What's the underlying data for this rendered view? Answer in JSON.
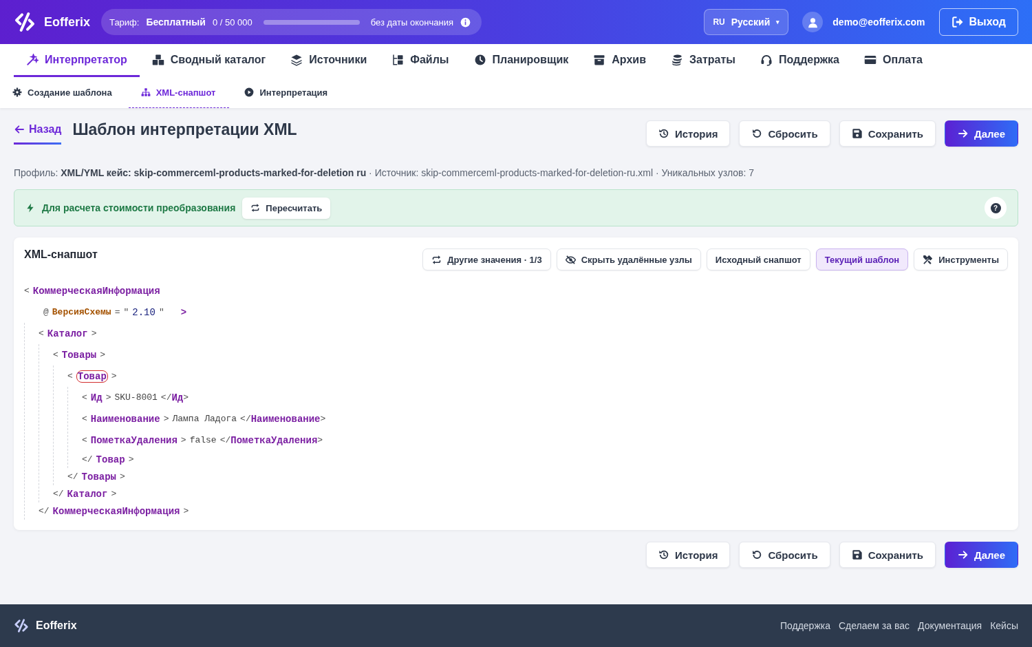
{
  "header": {
    "brand": "Eofferix",
    "plan": {
      "label": "Тариф:",
      "name": "Бесплатный",
      "usage": "0 / 50 000",
      "level": 0,
      "expiry": "без даты окончания"
    },
    "language": {
      "code": "RU",
      "name": "Русский",
      "caret": "▾"
    },
    "user": "demo@eofferix.com",
    "logout": "Выход"
  },
  "nav": [
    {
      "label": "Интерпретатор",
      "selected": true
    },
    {
      "label": "Сводный каталог",
      "selected": false
    },
    {
      "label": "Источники",
      "selected": false
    },
    {
      "label": "Файлы",
      "selected": false
    },
    {
      "label": "Планировщик",
      "selected": false
    },
    {
      "label": "Архив",
      "selected": false
    },
    {
      "label": "Затраты",
      "selected": false
    },
    {
      "label": "Поддержка",
      "selected": false
    },
    {
      "label": "Оплата",
      "selected": false
    }
  ],
  "subnav": [
    {
      "label": "Создание шаблона",
      "selected": false
    },
    {
      "label": "XML-снапшот",
      "selected": true
    },
    {
      "label": "Интерпретация",
      "selected": false
    }
  ],
  "page": {
    "back": "Назад",
    "title": "Шаблон интерпретации XML",
    "actions": [
      "История",
      "Сбросить",
      "Сохранить",
      "Далее"
    ],
    "meta": "Профиль: **XML/YML кейс: skip-commerceml-products-marked-for-deletion ru** · Источник: skip-commerceml-products-marked-for-deletion-ru.xml · Уникальных узлов: 7"
  },
  "banner": {
    "text": "Для расчета стоимости преобразования",
    "button": "Пересчитать",
    "help": "?"
  },
  "snapshot": {
    "title": "XML-снапшот",
    "toolbar": [
      {
        "label": "Другие значения · 1/3",
        "selected": false
      },
      {
        "label": "Скрыть удалённые узлы",
        "selected": false
      },
      {
        "label": "Исходный снапшот",
        "selected": false
      },
      {
        "label": "Текущий шаблон",
        "selected": true
      },
      {
        "label": "Инструменты",
        "selected": false
      }
    ],
    "syntax": {
      "open": "<",
      "close": ">",
      "end_open": "</",
      "attr_mark": "@",
      "eq": "=",
      "quote": "\""
    },
    "root": {
      "tag": "КоммерческаяИнформация",
      "end_tag": "КоммерческаяИнформация",
      "marked": false,
      "attributes": [
        {
          "name": "ВерсияСхемы",
          "value": "2.10"
        }
      ],
      "children": [
        {
          "tag": "Каталог",
          "end_tag": "Каталог",
          "marked": false,
          "children": [
            {
              "tag": "Товары",
              "end_tag": "Товары",
              "marked": false,
              "children": [
                {
                  "tag": "Товар",
                  "end_tag": "Товар",
                  "marked": true,
                  "children": [
                    {
                      "tag": "Ид",
                      "end_tag": "Ид",
                      "marked": false,
                      "text": "SKU-8001"
                    },
                    {
                      "tag": "Наименование",
                      "end_tag": "Наименование",
                      "marked": false,
                      "text": "Лампа Ладога"
                    },
                    {
                      "tag": "ПометкаУдаления",
                      "end_tag": "ПометкаУдаления",
                      "marked": false,
                      "text": "false"
                    }
                  ]
                }
              ]
            }
          ]
        }
      ]
    }
  },
  "bottom_actions": [
    "История",
    "Сбросить",
    "Сохранить",
    "Далее"
  ],
  "footer": {
    "brand": "Eofferix",
    "links": [
      "Поддержка",
      "Сделаем за вас",
      "Документация",
      "Кейсы"
    ]
  }
}
